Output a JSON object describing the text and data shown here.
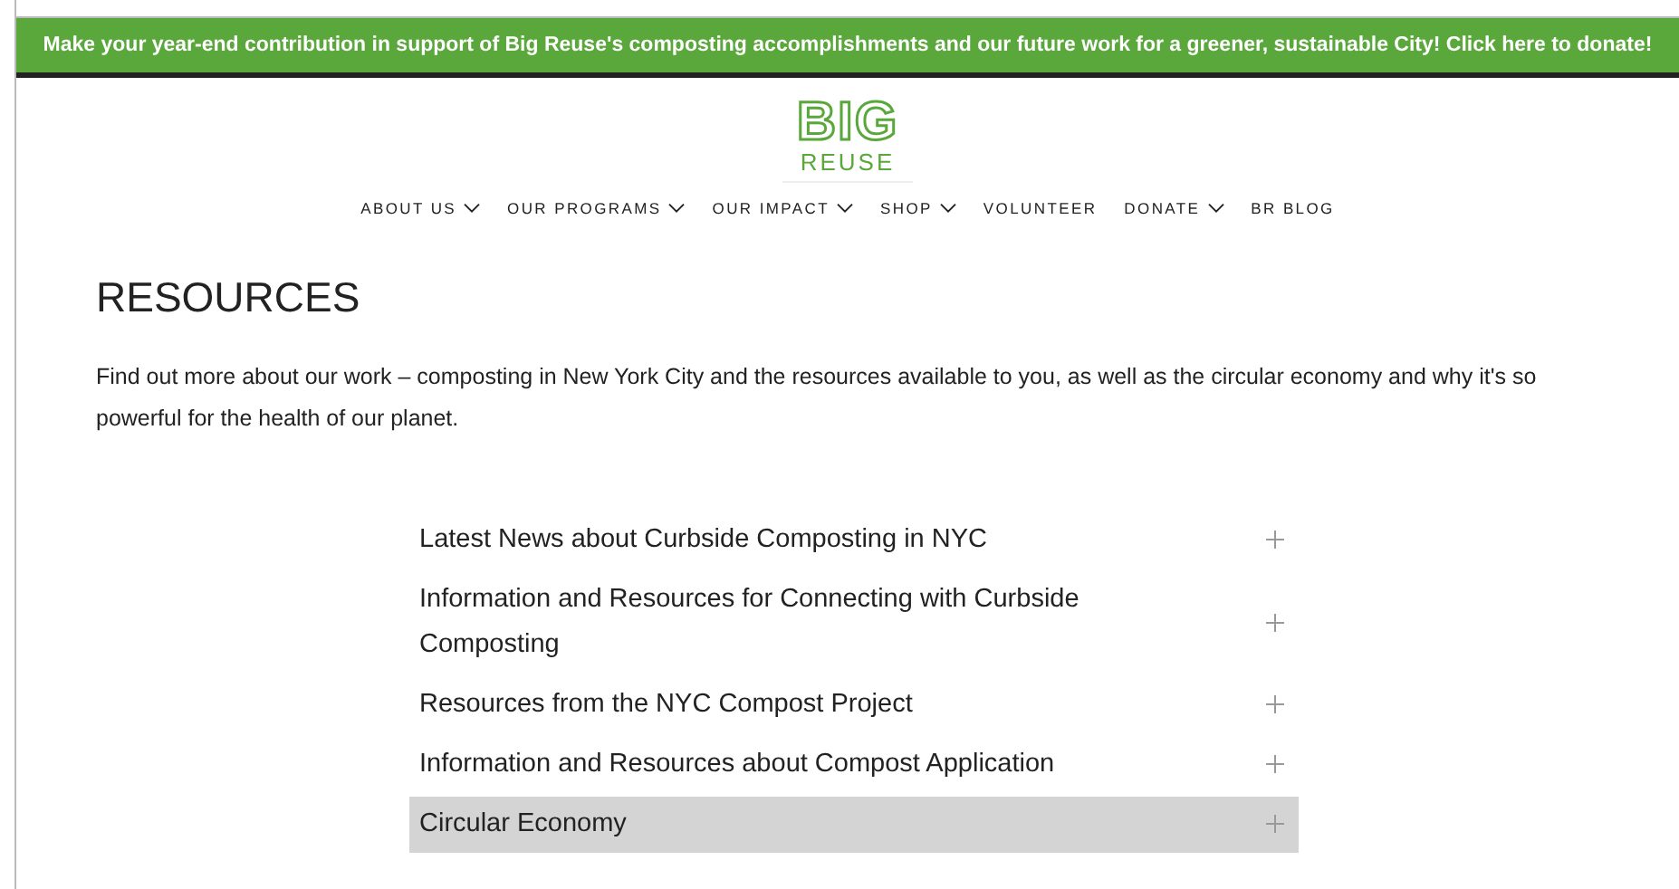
{
  "banner": {
    "text": "Make your year-end contribution in support of Big Reuse's composting accomplishments and our future work for a greener, sustainable City! Click here to donate!"
  },
  "logo": {
    "top": "BIG",
    "bottom": "REUSE"
  },
  "nav": [
    {
      "label": "ABOUT US",
      "dropdown": true
    },
    {
      "label": "OUR PROGRAMS",
      "dropdown": true
    },
    {
      "label": "OUR IMPACT",
      "dropdown": true
    },
    {
      "label": "SHOP",
      "dropdown": true
    },
    {
      "label": "VOLUNTEER",
      "dropdown": false
    },
    {
      "label": "DONATE",
      "dropdown": true
    },
    {
      "label": "BR BLOG",
      "dropdown": false
    }
  ],
  "page": {
    "title": "RESOURCES",
    "intro": "Find out more about our work – composting in New York City and the resources available to you, as well as the circular economy and why it's so powerful for the health of our planet."
  },
  "accordion": [
    {
      "title": "Latest News about Curbside Composting in NYC",
      "highlighted": false,
      "expanded": false
    },
    {
      "title": "Information and Resources for Connecting with Curbside Composting",
      "highlighted": false,
      "expanded": false
    },
    {
      "title": "Resources from the NYC Compost Project",
      "highlighted": false,
      "expanded": false
    },
    {
      "title": "Information and Resources about Compost Application",
      "highlighted": false,
      "expanded": false
    },
    {
      "title": "Circular Economy",
      "highlighted": true,
      "expanded": false
    }
  ]
}
